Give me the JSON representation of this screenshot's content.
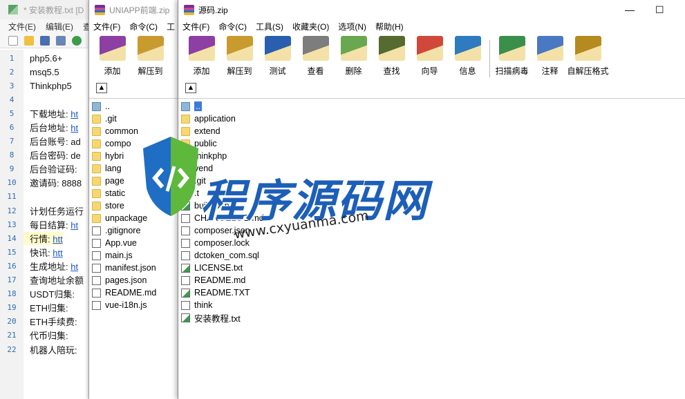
{
  "editor": {
    "title": "* 安装教程.txt [D",
    "menu": [
      "文件(E)",
      "编辑(E)",
      "查"
    ],
    "lines": [
      {
        "n": "1",
        "t": "php5.6+",
        "link": ""
      },
      {
        "n": "2",
        "t": "msq5.5",
        "link": ""
      },
      {
        "n": "3",
        "t": "Thinkphp5",
        "link": ""
      },
      {
        "n": "4",
        "t": "",
        "link": ""
      },
      {
        "n": "5",
        "t": "下载地址: ",
        "link": "ht"
      },
      {
        "n": "6",
        "t": "后台地址: ",
        "link": "ht"
      },
      {
        "n": "7",
        "t": "后台账号: ad",
        "link": ""
      },
      {
        "n": "8",
        "t": "后台密码: de",
        "link": ""
      },
      {
        "n": "9",
        "t": "后台验证码: ",
        "link": ""
      },
      {
        "n": "10",
        "t": "邀请码: 8888",
        "link": ""
      },
      {
        "n": "11",
        "t": "",
        "link": ""
      },
      {
        "n": "12",
        "t": "计划任务运行",
        "link": ""
      },
      {
        "n": "13",
        "t": "每日结算: ",
        "link": "ht"
      },
      {
        "n": "14",
        "t": "行情:     ",
        "link": "htt"
      },
      {
        "n": "15",
        "t": "快讯:     ",
        "link": "htt"
      },
      {
        "n": "16",
        "t": "生成地址: ",
        "link": "ht"
      },
      {
        "n": "17",
        "t": "查询地址余额",
        "link": ""
      },
      {
        "n": "18",
        "t": "USDT归集: ",
        "link": ""
      },
      {
        "n": "19",
        "t": "ETH归集: ",
        "link": ""
      },
      {
        "n": "20",
        "t": "ETH手续费: ",
        "link": ""
      },
      {
        "n": "21",
        "t": "代币归集: ",
        "link": ""
      },
      {
        "n": "22",
        "t": "机器人陪玩: ",
        "link": ""
      }
    ]
  },
  "uniapp": {
    "title": "UNIAPP前端.zip",
    "menu": [
      "文件(F)",
      "命令(C)",
      "工"
    ],
    "tools": [
      "添加",
      "解压到"
    ],
    "files": [
      {
        "name": "..",
        "kind": "up"
      },
      {
        "name": ".git",
        "kind": "folder"
      },
      {
        "name": "common",
        "kind": "folder"
      },
      {
        "name": "compo",
        "kind": "folder"
      },
      {
        "name": "hybri",
        "kind": "folder"
      },
      {
        "name": "lang",
        "kind": "folder"
      },
      {
        "name": "page",
        "kind": "folder"
      },
      {
        "name": "static",
        "kind": "folder"
      },
      {
        "name": "store",
        "kind": "folder"
      },
      {
        "name": "unpackage",
        "kind": "folder"
      },
      {
        "name": ".gitignore",
        "kind": "doc"
      },
      {
        "name": "App.vue",
        "kind": "doc"
      },
      {
        "name": "main.js",
        "kind": "doc"
      },
      {
        "name": "manifest.json",
        "kind": "doc"
      },
      {
        "name": "pages.json",
        "kind": "doc"
      },
      {
        "name": "README.md",
        "kind": "doc"
      },
      {
        "name": "vue-i18n.js",
        "kind": "doc"
      }
    ]
  },
  "zip": {
    "title": "源码.zip",
    "minimize": "—",
    "maximize": "☐",
    "menu": [
      "文件(F)",
      "命令(C)",
      "工具(S)",
      "收藏夹(O)",
      "选项(N)",
      "帮助(H)"
    ],
    "tools": [
      "添加",
      "解压到",
      "测试",
      "查看",
      "删除",
      "查找",
      "向导",
      "信息",
      "扫描病毒",
      "注释",
      "自解压格式"
    ],
    "files": [
      {
        "name": "..",
        "kind": "up"
      },
      {
        "name": "application",
        "kind": "folder"
      },
      {
        "name": "extend",
        "kind": "folder"
      },
      {
        "name": "public",
        "kind": "folder"
      },
      {
        "name": "thinkphp",
        "kind": "folder"
      },
      {
        "name": "vend",
        "kind": "folder"
      },
      {
        "name": ".git",
        "kind": "doc"
      },
      {
        "name": ".t",
        "kind": "doc"
      },
      {
        "name": "build.php",
        "kind": "green"
      },
      {
        "name": "CHANGELOG.md",
        "kind": "doc"
      },
      {
        "name": "composer.json",
        "kind": "doc"
      },
      {
        "name": "composer.lock",
        "kind": "doc"
      },
      {
        "name": "dctoken_com.sql",
        "kind": "doc"
      },
      {
        "name": "LICENSE.txt",
        "kind": "green"
      },
      {
        "name": "README.md",
        "kind": "doc"
      },
      {
        "name": "README.TXT",
        "kind": "green"
      },
      {
        "name": "think",
        "kind": "doc"
      },
      {
        "name": "安装教程.txt",
        "kind": "green"
      }
    ]
  },
  "watermark": {
    "title": "程序源码网",
    "url": "www.cxyuanma.com"
  }
}
